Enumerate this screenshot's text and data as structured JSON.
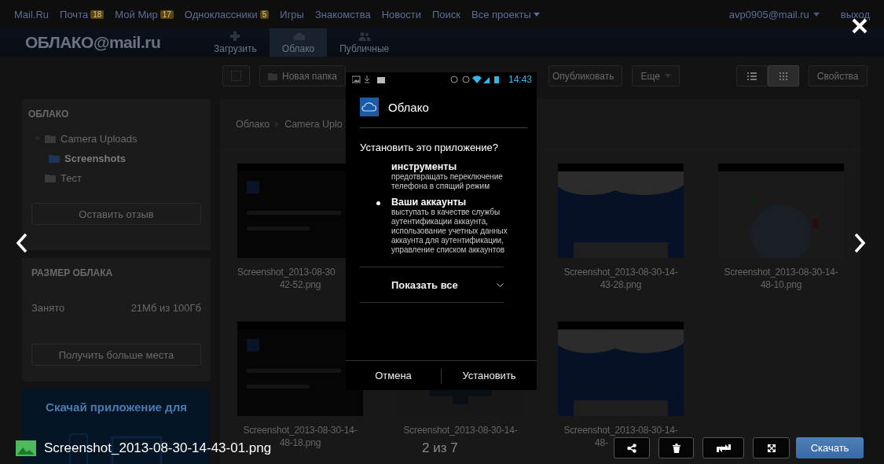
{
  "top_bar": {
    "links": [
      {
        "label": "Mail.Ru"
      },
      {
        "label": "Почта",
        "badge": "18"
      },
      {
        "label": "Мой Мир",
        "badge": "17"
      },
      {
        "label": "Одноклассники",
        "badge": "5"
      },
      {
        "label": "Игры"
      },
      {
        "label": "Знакомства"
      },
      {
        "label": "Новости"
      },
      {
        "label": "Поиск"
      },
      {
        "label": "Все проекты",
        "dropdown": true
      }
    ],
    "account": "avp0905@mail.ru",
    "logout": "выход"
  },
  "header": {
    "logo": "ОБЛАКО@mail.ru",
    "nav": [
      {
        "label": "Загрузить",
        "kind": "upload",
        "selected": false
      },
      {
        "label": "Облако",
        "kind": "cloud",
        "selected": true
      },
      {
        "label": "Публичные",
        "kind": "people",
        "selected": false
      }
    ]
  },
  "toolbar": {
    "select_all": {
      "checked": false
    },
    "buttons": [
      {
        "label": "Новая папка",
        "kind": "folder"
      },
      {
        "label": "Опубликовать",
        "kind": "link"
      },
      {
        "label": "Еще",
        "kind": "menu"
      }
    ],
    "views": [
      {
        "kind": "list",
        "selected": false
      },
      {
        "kind": "grid",
        "selected": true
      }
    ],
    "properties": "Свойства"
  },
  "sidebar": {
    "title": "ОБЛАКО",
    "tree": [
      {
        "label": "Camera Uploads",
        "expanded": true,
        "selected": false,
        "children": [
          {
            "label": "Screenshots",
            "selected": true
          }
        ]
      },
      {
        "label": "Тест",
        "selected": false
      }
    ],
    "feedback_button": "Оставить отзыв"
  },
  "storage": {
    "title": "РАЗМЕР ОБЛАКА",
    "used_label": "Занято",
    "used_value": "21Мб из 100Гб",
    "more_button": "Получить больше места"
  },
  "promo": {
    "title": "Скачай приложение для"
  },
  "main": {
    "breadcrumb": [
      "Облако",
      "Camera Uplo"
    ],
    "rows": [
      [
        {
          "lines": [
            "Screenshot_2013-08-30",
            "42-52.png"
          ]
        },
        {},
        {
          "lines": [
            "Screenshot_2013-08-30-14-",
            "43-28.png"
          ]
        },
        {
          "lines": [
            "Screenshot_2013-08-30-14-",
            "48-10.png"
          ]
        }
      ],
      [
        {
          "lines": [
            "Screenshot_2013-08-30-14-",
            "48-18.png"
          ]
        },
        {
          "lines": [
            "Screenshot_2013-08-30-14-"
          ]
        },
        {
          "lines": [
            "Screenshot_2013-08-30-14-",
            "48-"
          ]
        }
      ]
    ]
  },
  "viewer": {
    "image": {
      "time": "14:43",
      "app_title": "Облако",
      "question": "Установить это приложение?",
      "permissions": [
        {
          "title": "инструменты",
          "desc": "предотвращать переключение телефона в спящий режим",
          "bullet": false
        },
        {
          "title": "Ваши аккаунты",
          "desc": "выступать в качестве службы аутентификации аккаунта, использование учетных данных аккаунта для аутентификации, управление списком аккаунтов",
          "bullet": true
        }
      ],
      "show_all": "Показать все",
      "buttons": [
        "Отмена",
        "Установить"
      ]
    },
    "filename": "Screenshot_2013-08-30-14-43-01.png",
    "counter": "2 из 7",
    "actions": [
      {
        "kind": "share"
      },
      {
        "kind": "delete"
      },
      {
        "kind": "rotate"
      },
      {
        "kind": "fullscreen"
      }
    ],
    "download": "Скачать"
  }
}
